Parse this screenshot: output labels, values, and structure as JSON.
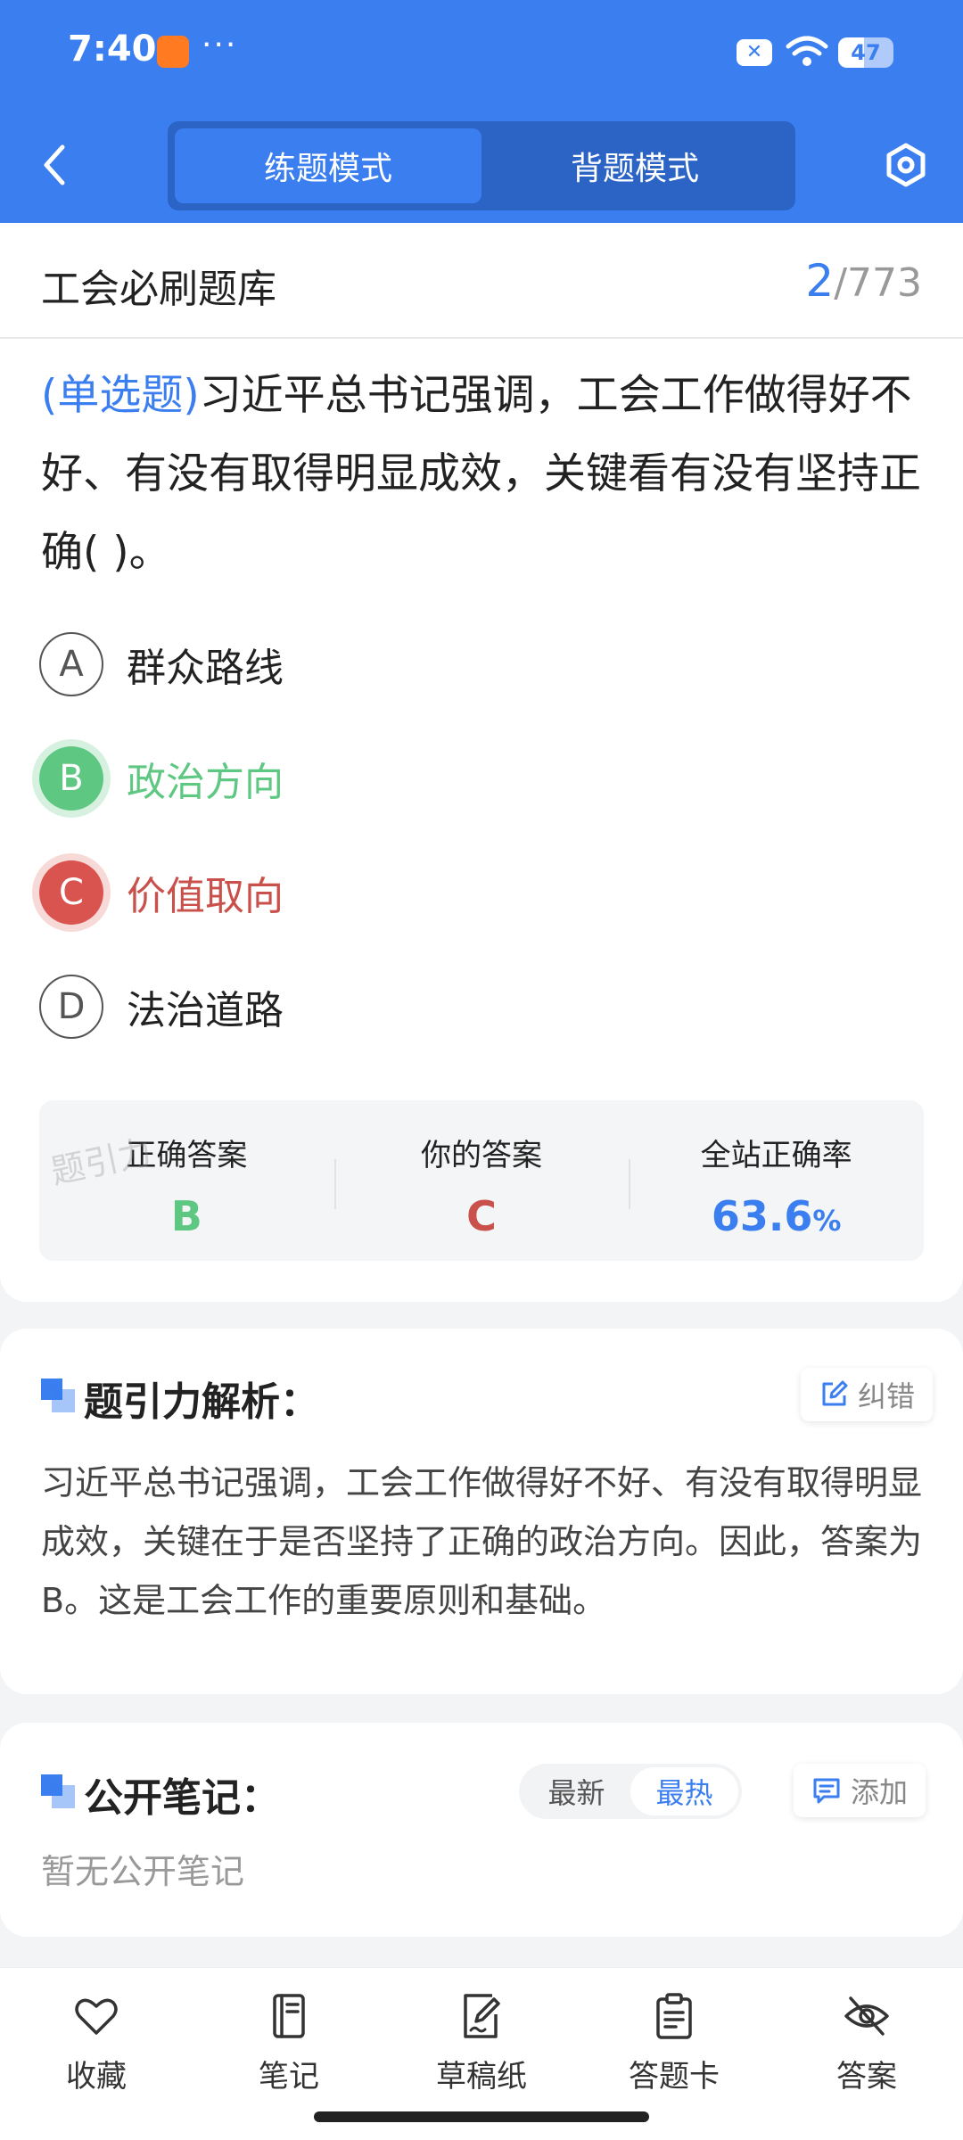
{
  "status_bar": {
    "time": "7:40",
    "dots": "···",
    "network_badge": "✕",
    "battery": "47",
    "battery_level": 0.47
  },
  "header": {
    "tabs": [
      {
        "label": "练题模式",
        "active": true
      },
      {
        "label": "背题模式",
        "active": false
      }
    ]
  },
  "bank": {
    "title": "工会必刷题库",
    "current": "2",
    "separator": "/",
    "total": "773"
  },
  "question": {
    "type": "(单选题)",
    "text": "习近平总书记强调，工会工作做得好不好、有没有取得明显成效，关键看有没有坚持正确( )。"
  },
  "options": [
    {
      "letter": "A",
      "text": "群众路线",
      "state": "normal"
    },
    {
      "letter": "B",
      "text": "政治方向",
      "state": "correct"
    },
    {
      "letter": "C",
      "text": "价值取向",
      "state": "wrong"
    },
    {
      "letter": "D",
      "text": "法治道路",
      "state": "normal"
    }
  ],
  "stats": {
    "correct_label": "正确答案",
    "correct_value": "B",
    "yours_label": "你的答案",
    "yours_value": "C",
    "rate_label": "全站正确率",
    "rate_value": "63.6",
    "rate_unit": "%"
  },
  "watermark": "题引力",
  "analysis": {
    "title": "题引力解析：",
    "report_label": "纠错",
    "text": "习近平总书记强调，工会工作做得好不好、有没有取得明显成效，关键在于是否坚持了正确的政治方向。因此，答案为B。这是工会工作的重要原则和基础。"
  },
  "notes": {
    "title": "公开笔记：",
    "sort_options": [
      "最新",
      "最热"
    ],
    "add_label": "添加",
    "empty_text": "暂无公开笔记"
  },
  "toolbar": [
    {
      "label": "收藏",
      "icon": "heart-icon"
    },
    {
      "label": "笔记",
      "icon": "notebook-icon"
    },
    {
      "label": "草稿纸",
      "icon": "draft-icon"
    },
    {
      "label": "答题卡",
      "icon": "answer-card-icon"
    },
    {
      "label": "答案",
      "icon": "eye-off-icon"
    }
  ],
  "colors": {
    "brand": "#3a7ef0",
    "correct": "#5ec882",
    "wrong": "#d9534f"
  }
}
